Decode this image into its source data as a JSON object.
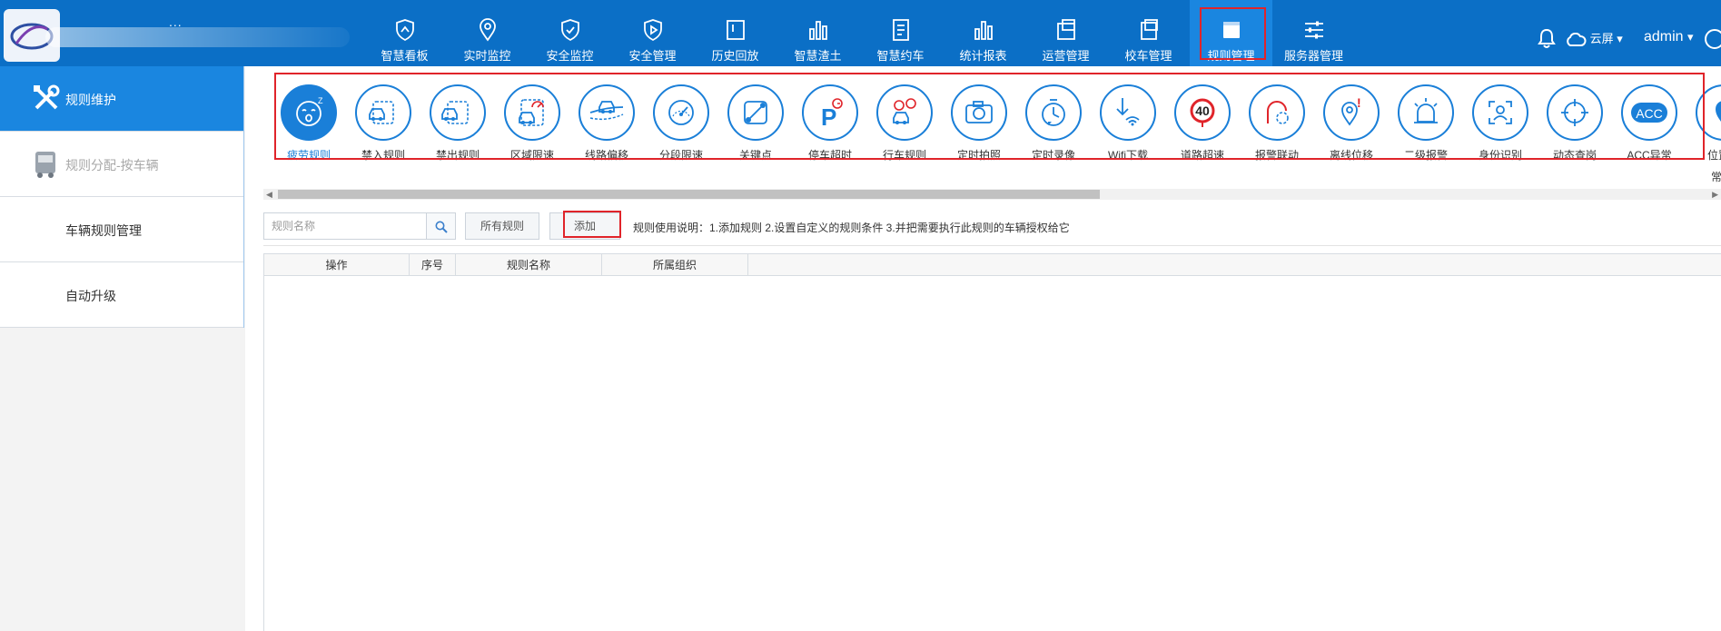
{
  "header": {
    "brand_dots": "...",
    "nav": [
      {
        "label": "智慧看板",
        "icon": "shield-dashboard-icon"
      },
      {
        "label": "实时监控",
        "icon": "location-pin-icon"
      },
      {
        "label": "安全监控",
        "icon": "shield-check-icon"
      },
      {
        "label": "安全管理",
        "icon": "shield-play-icon"
      },
      {
        "label": "历史回放",
        "icon": "history-playback-icon"
      },
      {
        "label": "智慧渣土",
        "icon": "bar-chart-icon"
      },
      {
        "label": "智慧约车",
        "icon": "document-list-icon"
      },
      {
        "label": "统计报表",
        "icon": "bar-chart-icon"
      },
      {
        "label": "运营管理",
        "icon": "operations-icon"
      },
      {
        "label": "校车管理",
        "icon": "school-bus-icon"
      },
      {
        "label": "规则管理",
        "icon": "rules-folder-icon",
        "active": true
      },
      {
        "label": "服务器管理",
        "icon": "sliders-icon"
      }
    ],
    "cloud_label": "云屏",
    "user": "admin"
  },
  "sidebar": {
    "items": [
      {
        "label": "规则维护",
        "icon": "tools-icon",
        "active": true
      },
      {
        "label": "规则分配-按车辆",
        "icon": "bus-icon",
        "disabled": true
      },
      {
        "label": "车辆规则管理"
      },
      {
        "label": "自动升级"
      }
    ]
  },
  "rules": [
    {
      "label": "疲劳规则",
      "icon": "fatigue-face-icon",
      "selected": true
    },
    {
      "label": "禁入规则",
      "icon": "no-entry-car-icon"
    },
    {
      "label": "禁出规则",
      "icon": "no-exit-car-icon"
    },
    {
      "label": "区域限速",
      "icon": "area-speed-icon"
    },
    {
      "label": "线路偏移",
      "icon": "route-deviation-icon"
    },
    {
      "label": "分段限速",
      "icon": "speedometer-icon"
    },
    {
      "label": "关键点",
      "icon": "key-point-icon"
    },
    {
      "label": "停车超时",
      "icon": "parking-timeout-icon"
    },
    {
      "label": "行车规则",
      "icon": "driving-rule-icon"
    },
    {
      "label": "定时拍照",
      "icon": "camera-icon"
    },
    {
      "label": "定时录像",
      "icon": "timer-record-icon"
    },
    {
      "label": "Wifi下载",
      "icon": "wifi-download-icon"
    },
    {
      "label": "道路超速",
      "icon": "speed-limit-40-icon",
      "badge": "40"
    },
    {
      "label": "报警联动",
      "icon": "alarm-link-icon"
    },
    {
      "label": "离线位移",
      "icon": "offline-move-icon"
    },
    {
      "label": "二级报警",
      "icon": "alarm-light-icon"
    },
    {
      "label": "身份识别",
      "icon": "face-id-icon"
    },
    {
      "label": "动态查岗",
      "icon": "crosshair-icon"
    },
    {
      "label": "ACC异常",
      "icon": "acc-icon",
      "badge": "ACC"
    },
    {
      "label": "位置上",
      "icon": "location-icon"
    }
  ],
  "rules_overflow_text": "常",
  "toolbar": {
    "search_placeholder": "规则名称",
    "all_rules_label": "所有规则",
    "add_label": "添加",
    "usage_text": "规则使用说明：1.添加规则 2.设置自定义的规则条件 3.并把需要执行此规则的车辆授权给它"
  },
  "table": {
    "columns": [
      "操作",
      "序号",
      "规则名称",
      "所属组织"
    ],
    "rows": []
  },
  "colors": {
    "header_bg": "#0b6fc6",
    "active_bg": "#1a86e0",
    "accent": "#1a7fd8",
    "highlight_border": "#e0242a"
  }
}
